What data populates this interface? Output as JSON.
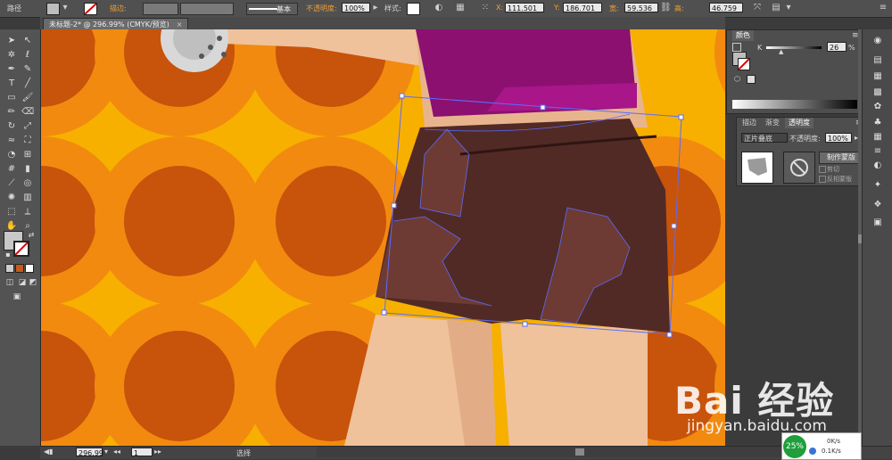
{
  "control_bar": {
    "object_type": "路径",
    "stroke_label": "描边:",
    "stroke_profile": "基本",
    "opacity_label": "不透明度:",
    "opacity_value": "100%",
    "style_label": "样式:",
    "x_label": "X:",
    "x_value": "111.501",
    "y_label": "Y:",
    "y_value": "186.701",
    "w_label": "宽:",
    "w_value": "59.536",
    "h_label": "高:",
    "h_value": "46.759"
  },
  "document_tab": {
    "title": "未标题-2* @ 296.99% (CMYK/预览)",
    "close": "×"
  },
  "color_panel": {
    "tab": "颜色",
    "channel": "K",
    "value": "26",
    "unit": "%"
  },
  "transparency_panel": {
    "tabs": [
      "描边",
      "渐变",
      "透明度"
    ],
    "blend_mode": "正片叠底",
    "opacity_label": "不透明度:",
    "opacity_value": "100%",
    "make_mask_button": "制作蒙版",
    "clip_label": "剪切",
    "invert_label": "反相蒙版"
  },
  "status_bar": {
    "zoom": "296.99",
    "artboard": "1",
    "tool": "选择"
  },
  "watermark": {
    "brand": "Bai  经验",
    "url": "jingyan.baidu.com"
  },
  "net_widget": {
    "percent": "25%",
    "up": "0K/s",
    "down": "0.1K/s"
  },
  "colors": {
    "canvas_bg": "#f7b000",
    "ring_outer": "#f28a10",
    "ring_inner": "#c8530a",
    "shorts": "#522a25",
    "shorts_patch": "#6e3b34",
    "top": "#8c1070",
    "skin": "#efc29c",
    "selection": "#5a6cff"
  }
}
